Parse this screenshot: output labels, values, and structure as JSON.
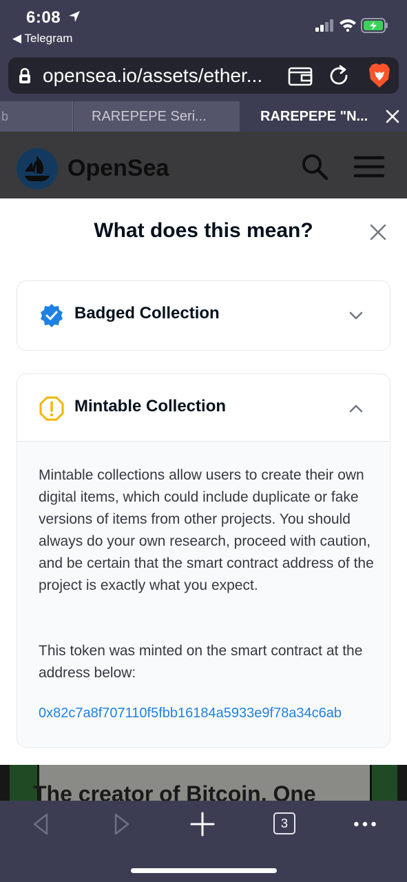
{
  "status_bar": {
    "time": "6:08",
    "back_app": "◀ Telegram"
  },
  "browser": {
    "url": "opensea.io/assets/ether...",
    "tabs": [
      {
        "label": "RAREPEPE Seri...",
        "active": false
      },
      {
        "label": "RAREPEPE \"N...",
        "active": true
      }
    ],
    "tab_count": "3"
  },
  "site_header": {
    "brand": "OpenSea"
  },
  "modal": {
    "title": "What does this mean?",
    "sections": [
      {
        "label": "Badged Collection",
        "expanded": false,
        "icon": "verified-badge-icon"
      },
      {
        "label": "Mintable Collection",
        "expanded": true,
        "icon": "warning-icon",
        "paragraph1": "Mintable collections allow users to create their own digital items, which could include duplicate or fake versions of items from other projects. You should always do your own research, proceed with caution, and be certain that the smart contract address of the project is exactly what you expect.",
        "paragraph2": "This token was minted on the smart contract at the address below:",
        "address": "0x82c7a8f707110f5fbb16184a5933e9f78a34c6ab"
      }
    ]
  },
  "underlying": {
    "image_text": "The creator of Bitcoin. One"
  },
  "colors": {
    "chrome": "#3c3d52",
    "accent_blue": "#2081e2",
    "warning_yellow": "#f5b400",
    "text_dark": "#04111d"
  }
}
